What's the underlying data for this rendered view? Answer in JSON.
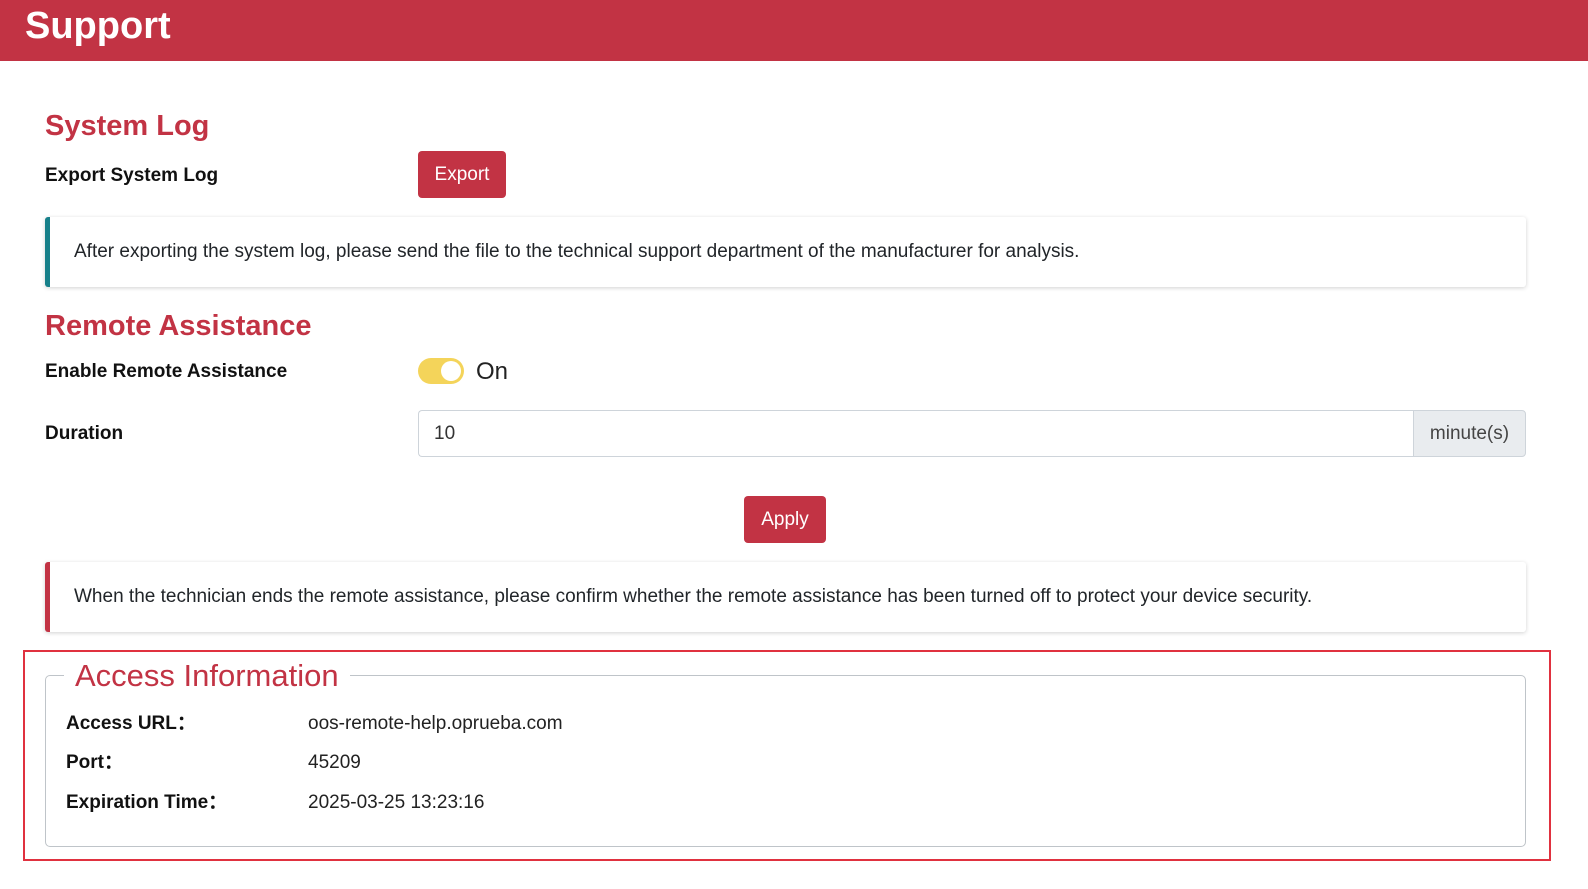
{
  "header": {
    "title": "Support"
  },
  "system_log": {
    "title": "System Log",
    "export_label": "Export System Log",
    "export_button": "Export",
    "note": "After exporting the system log, please send the file to the technical support department of the manufacturer for analysis."
  },
  "remote_assistance": {
    "title": "Remote Assistance",
    "enable_label": "Enable Remote Assistance",
    "enabled": true,
    "toggle_text": "On",
    "duration_label": "Duration",
    "duration_value": "10",
    "duration_unit": "minute(s)",
    "apply_button": "Apply",
    "note": "When the technician ends the remote assistance, please confirm whether the remote assistance has been turned off to protect your device security."
  },
  "access_info": {
    "title": "Access Information",
    "url_label": "Access URL：",
    "url_value": "oos-remote-help.oprueba.com",
    "port_label": "Port：",
    "port_value": "45209",
    "expiration_label": "Expiration Time：",
    "expiration_value": "2025-03-25 13:23:16"
  },
  "colors": {
    "brand": "#c23344",
    "info_accent": "#17808a",
    "toggle_on": "#f4d45a",
    "highlight": "#e0313f"
  }
}
